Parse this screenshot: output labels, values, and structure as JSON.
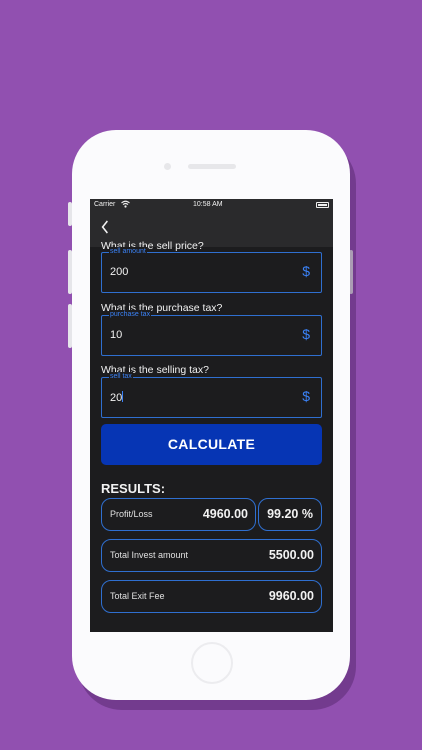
{
  "status": {
    "carrier": "Carrier",
    "time": "10:58 AM"
  },
  "nav": {
    "back_icon": "chevron-left-icon"
  },
  "questions": {
    "sell_price": "What is the sell price?",
    "purchase_tax": "What is the purchase tax?",
    "selling_tax": "What is the selling tax?"
  },
  "fields": {
    "sell_amount": {
      "label": "sell amount",
      "value": "200",
      "icon": "$"
    },
    "purchase_tax": {
      "label": "purchase tax",
      "value": "10",
      "icon": "$"
    },
    "sell_tax": {
      "label": "sell tax",
      "value": "20",
      "icon": "$"
    }
  },
  "calculate_label": "CALCULATE",
  "results": {
    "title": "RESULTS:",
    "profit_loss": {
      "label": "Profit/Loss",
      "value": "4960.00",
      "percent": "99.20 %"
    },
    "total_invest": {
      "label": "Total Invest amount",
      "value": "5500.00"
    },
    "total_exit_fee": {
      "label": "Total Exit Fee",
      "value": "9960.00"
    }
  },
  "colors": {
    "background": "#9150b0",
    "accent": "#3b82f6",
    "button": "#0635b4",
    "screen": "#1c1c1e"
  }
}
